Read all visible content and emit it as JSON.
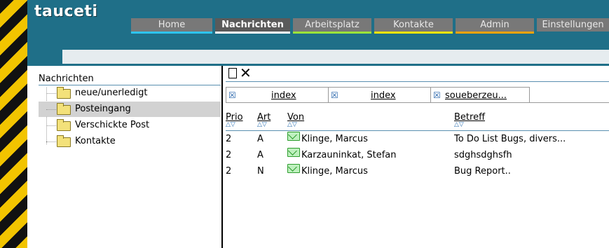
{
  "app": {
    "logo": "tauceti"
  },
  "nav": {
    "tabs": [
      {
        "label": "Home",
        "accent": "#2ec4f0"
      },
      {
        "label": "Nachrichten",
        "accent": "#ffffff",
        "active": true
      },
      {
        "label": "Arbeitsplatz",
        "accent": "#9be33a"
      },
      {
        "label": "Kontakte",
        "accent": "#f5e400"
      },
      {
        "label": "Admin",
        "accent": "#f5a300"
      },
      {
        "label": "Einstellungen",
        "accent": "#f56400"
      }
    ]
  },
  "sidebar": {
    "title": "Nachrichten",
    "items": [
      {
        "label": "neue/unerledigt",
        "icon": "folder-icon"
      },
      {
        "label": "Posteingang",
        "icon": "folder-icon",
        "selected": true
      },
      {
        "label": "Verschickte Post",
        "icon": "folder-icon"
      },
      {
        "label": "Kontakte",
        "icon": "folder-icon"
      }
    ]
  },
  "toolbar": {
    "new_icon": "new-document-icon",
    "delete_icon": "delete-icon"
  },
  "filter_tabs": [
    {
      "label": "index"
    },
    {
      "label": "index"
    },
    {
      "label": "soueberzeu..."
    }
  ],
  "table": {
    "columns": [
      "Prio",
      "Art",
      "Von",
      "Betreff"
    ],
    "sort_glyph": "△▽",
    "rows": [
      {
        "prio": "2",
        "art": "A",
        "von": "Klinge, Marcus",
        "betreff": "To Do List Bugs, divers..."
      },
      {
        "prio": "2",
        "art": "A",
        "von": "Karzauninkat, Stefan",
        "betreff": "sdghsdghsfh"
      },
      {
        "prio": "2",
        "art": "N",
        "von": "Klinge, Marcus",
        "betreff": "Bug Report.."
      }
    ]
  },
  "colors": {
    "header_bg": "#1f6f88",
    "tab_bg": "#787878",
    "selected_row": "#d2d2d2",
    "hazard_yellow": "#f2c400",
    "mail_icon": "#2e9d2e"
  }
}
